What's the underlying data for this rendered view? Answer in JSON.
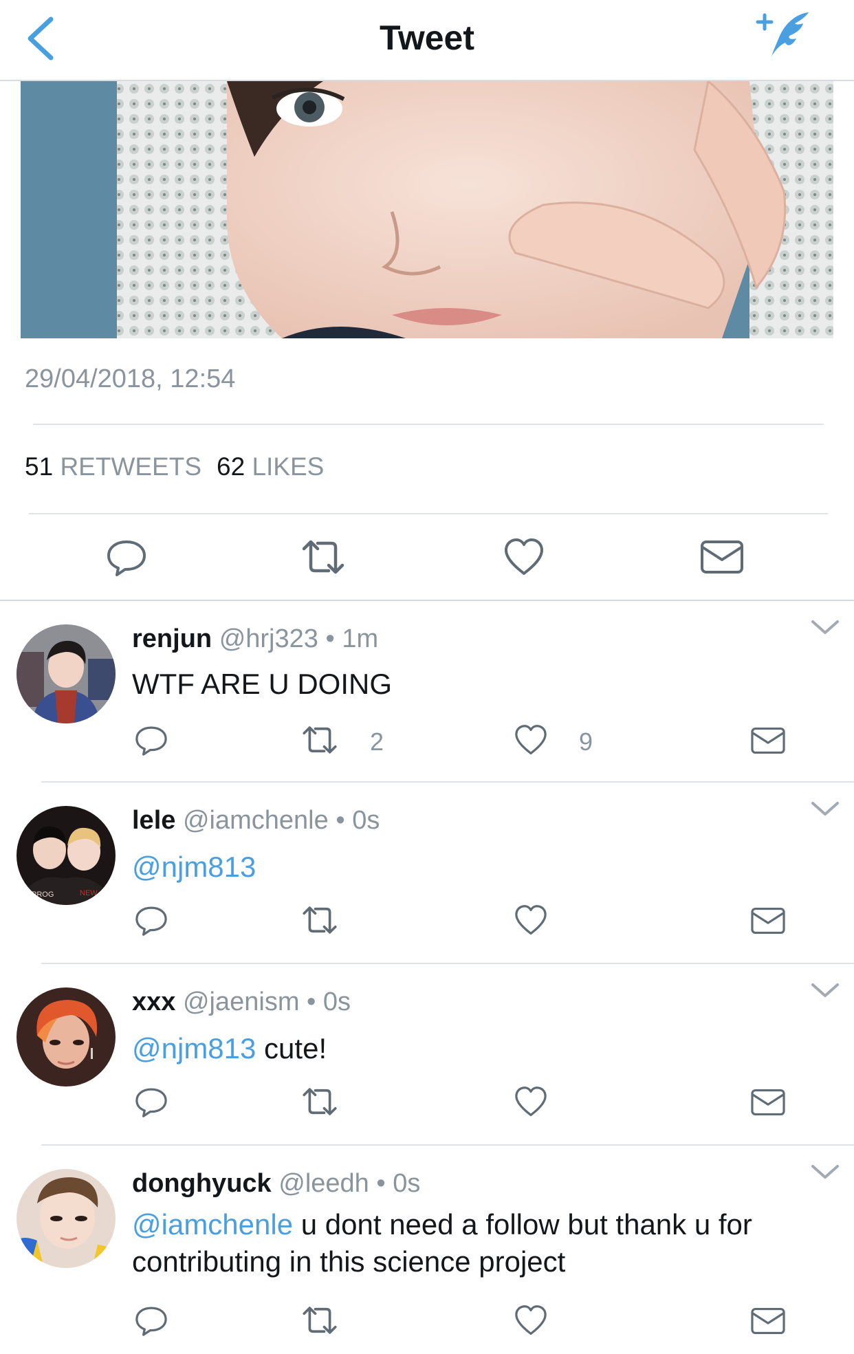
{
  "nav": {
    "title": "Tweet",
    "back_icon": "chevron-left-icon",
    "compose_icon": "compose-tweet-icon",
    "accent": "#4a9fe0"
  },
  "tweet": {
    "timestamp": "29/04/2018, 12:54",
    "retweets_count": "51",
    "retweets_label": "RETWEETS",
    "likes_count": "62",
    "likes_label": "LIKES"
  },
  "replies": [
    {
      "name": "renjun",
      "handle": "@hrj323",
      "time": "1m",
      "mention": "",
      "text": "WTF ARE U DOING",
      "retweets": "2",
      "likes": "9"
    },
    {
      "name": "lele",
      "handle": "@iamchenle",
      "time": "0s",
      "mention": "@njm813",
      "text": "",
      "retweets": "",
      "likes": ""
    },
    {
      "name": "xxx",
      "handle": "@jaenism",
      "time": "0s",
      "mention": "@njm813",
      "text": " cute!",
      "retweets": "",
      "likes": ""
    },
    {
      "name": "donghyuck",
      "handle": "@leedh",
      "time": "0s",
      "mention": "@iamchenle",
      "text": " u dont need a follow but thank u for contributing in this science project",
      "retweets": "",
      "likes": ""
    }
  ],
  "separator": "•"
}
